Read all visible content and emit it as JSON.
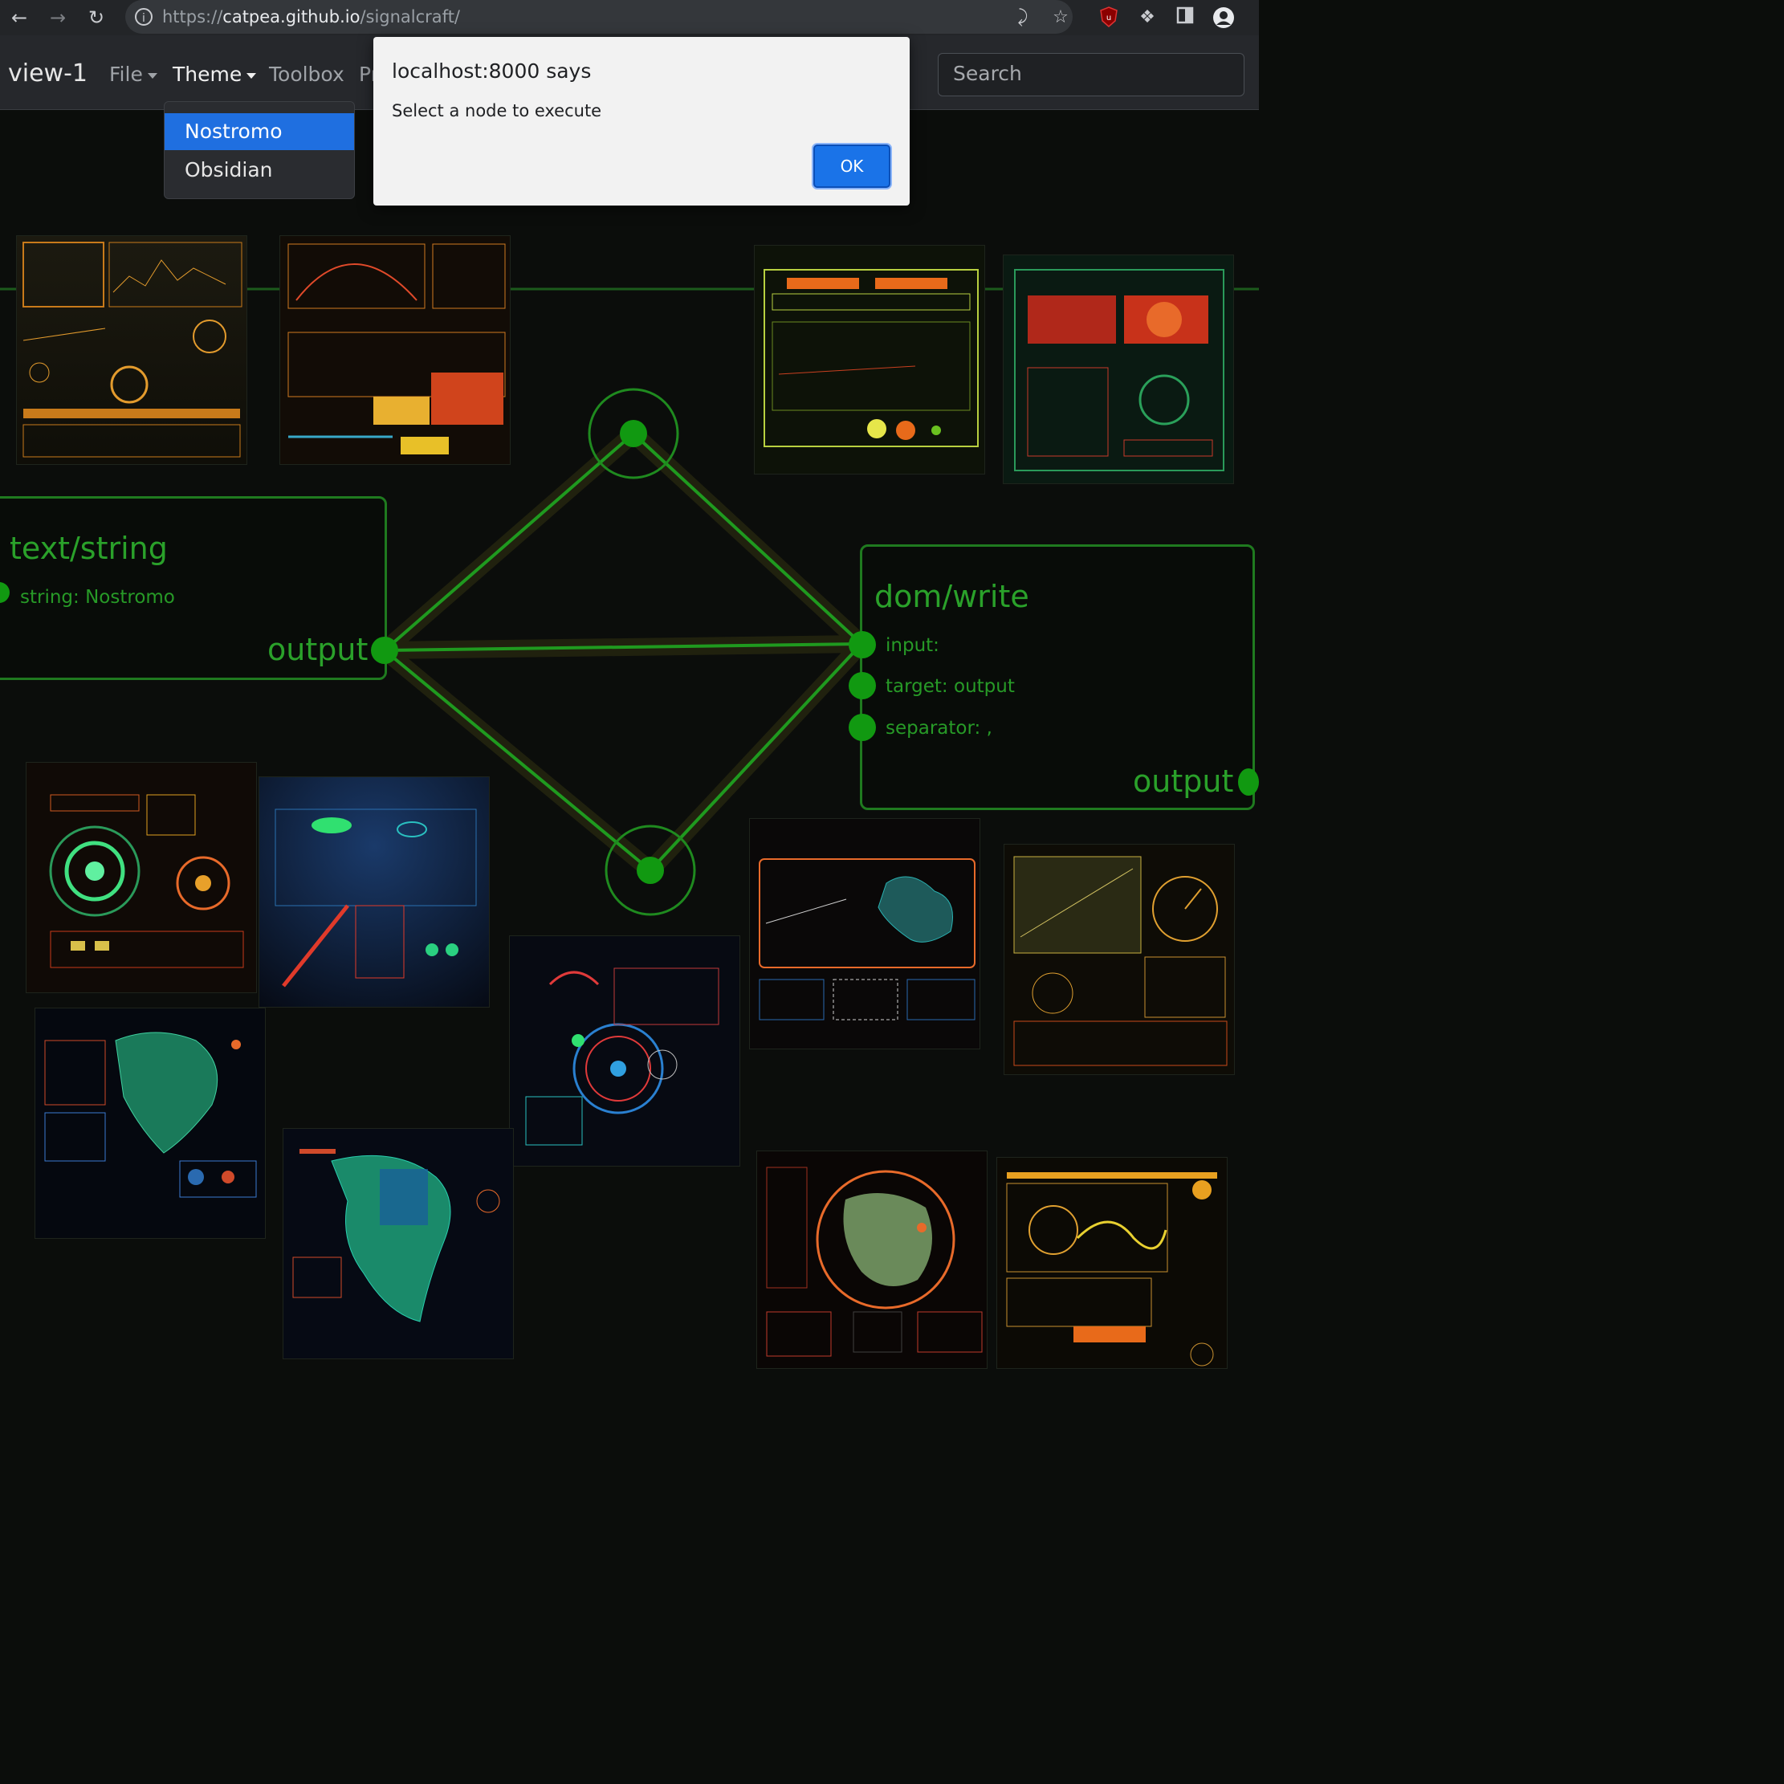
{
  "browser": {
    "url_prefix": "https://",
    "url_host": "catpea.github.io",
    "url_path": "/signalcraft/"
  },
  "app": {
    "brand": "view-1",
    "menus": [
      {
        "label": "File"
      },
      {
        "label": "Theme"
      },
      {
        "label": "Toolbox"
      },
      {
        "label": "Pr"
      }
    ],
    "search_placeholder": "Search"
  },
  "theme_dropdown": {
    "items": [
      {
        "label": "Nostromo",
        "selected": true
      },
      {
        "label": "Obsidian",
        "selected": false
      }
    ]
  },
  "dialog": {
    "title": "localhost:8000 says",
    "message": "Select a node to execute",
    "ok_label": "OK"
  },
  "nodes": {
    "text_string": {
      "title": "text/string",
      "fields": [
        "string: Nostromo"
      ],
      "output": "output"
    },
    "dom_write": {
      "title": "dom/write",
      "fields": [
        "input:",
        "target: output",
        "separator: ,"
      ],
      "output": "output"
    }
  },
  "colors": {
    "wire": "#1f9a1f",
    "accent": "#1a73e8",
    "node_border": "#1f7a1f"
  },
  "icons": [
    "back-icon",
    "forward-icon",
    "reload-icon",
    "info-icon",
    "share-icon",
    "star-icon",
    "ublock-icon",
    "puzzle-icon",
    "sidepanel-icon",
    "profile-icon"
  ]
}
